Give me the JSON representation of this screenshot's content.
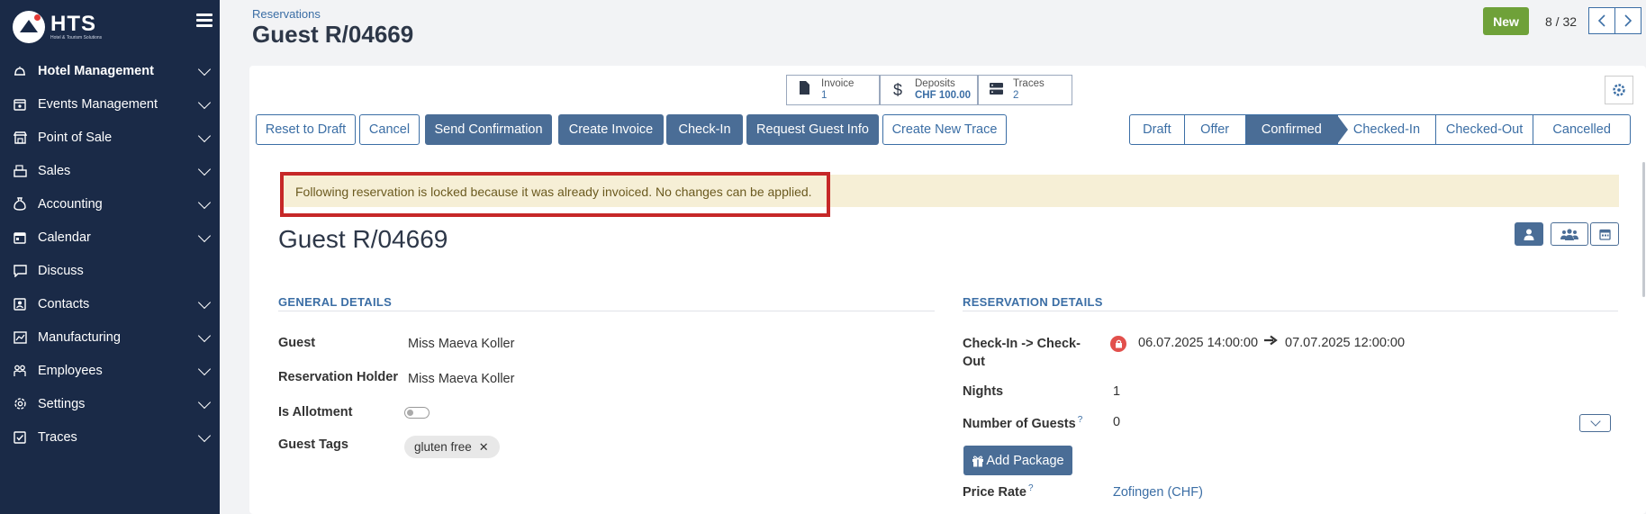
{
  "sidebar": {
    "logo_name": "HTS",
    "logo_sub": "Hotel & Tourism Solutions",
    "items": [
      {
        "label": "Hotel Management",
        "icon": "bell-icon"
      },
      {
        "label": "Events Management",
        "icon": "calendar-star-icon"
      },
      {
        "label": "Point of Sale",
        "icon": "store-icon"
      },
      {
        "label": "Sales",
        "icon": "cash-register-icon"
      },
      {
        "label": "Accounting",
        "icon": "money-bag-icon"
      },
      {
        "label": "Calendar",
        "icon": "calendar-icon"
      },
      {
        "label": "Discuss",
        "icon": "chat-icon"
      },
      {
        "label": "Contacts",
        "icon": "contacts-icon"
      },
      {
        "label": "Manufacturing",
        "icon": "chart-icon"
      },
      {
        "label": "Employees",
        "icon": "people-icon"
      },
      {
        "label": "Settings",
        "icon": "gear-icon"
      },
      {
        "label": "Traces",
        "icon": "checkbox-icon"
      }
    ]
  },
  "header": {
    "breadcrumb": "Reservations",
    "title": "Guest R/04669",
    "new_label": "New",
    "pager": "8 / 32"
  },
  "stats": {
    "invoice_label": "Invoice",
    "invoice_value": "1",
    "deposits_label": "Deposits",
    "deposits_value": "CHF 100.00",
    "traces_label": "Traces",
    "traces_value": "2"
  },
  "actions": {
    "reset": "Reset to Draft",
    "cancel": "Cancel",
    "send_confirmation": "Send Confirmation",
    "create_invoice": "Create Invoice",
    "check_in": "Check-In",
    "request_guest_info": "Request Guest Info",
    "create_new_trace": "Create New Trace"
  },
  "status": {
    "steps": [
      "Draft",
      "Offer",
      "Confirmed",
      "Checked-In",
      "Checked-Out",
      "Cancelled"
    ],
    "active": "Confirmed"
  },
  "alert": "Following reservation is locked because it was already invoiced. No changes can be applied.",
  "record": {
    "title": "Guest R/04669"
  },
  "general": {
    "section_title": "GENERAL DETAILS",
    "guest_label": "Guest",
    "guest_value": "Miss Maeva Koller",
    "holder_label": "Reservation Holder",
    "holder_value": "Miss Maeva Koller",
    "allotment_label": "Is Allotment",
    "allotment_value": false,
    "tags_label": "Guest Tags",
    "tags": [
      "gluten free"
    ]
  },
  "reservation": {
    "section_title": "RESERVATION DETAILS",
    "checkin_label_1": "Check-In -> Check-",
    "checkin_label_2": "Out",
    "checkin_from": "06.07.2025 14:00:00",
    "checkin_to": "07.07.2025 12:00:00",
    "nights_label": "Nights",
    "nights_value": "1",
    "guests_label": "Number of Guests",
    "guests_value": "0",
    "add_package": "Add Package",
    "price_rate_label": "Price Rate",
    "price_rate_value": "Zofingen (CHF)",
    "help_mark": "?"
  },
  "colors": {
    "sidebar_bg": "#1a2a47",
    "primary": "#4a6d96",
    "link": "#3b6ea5",
    "new_button": "#6fa139",
    "alert_bg": "#f6efd6",
    "highlight_border": "#c62828"
  }
}
